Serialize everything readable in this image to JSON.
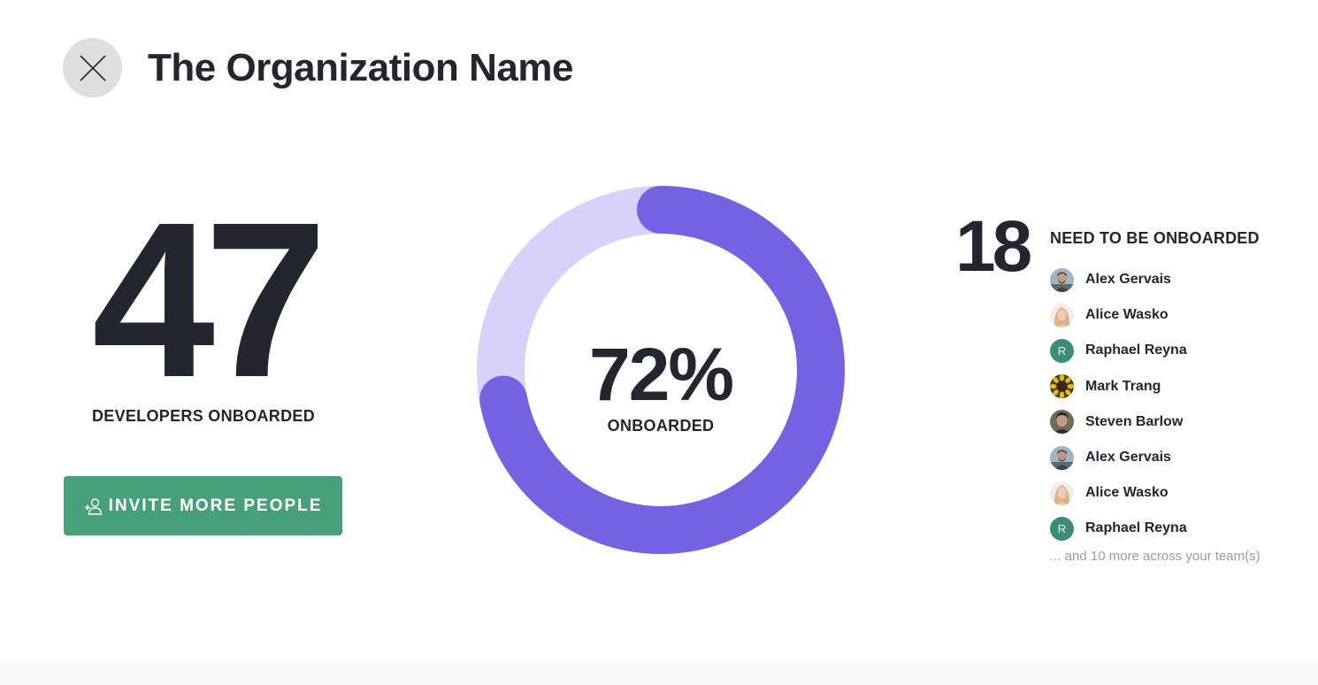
{
  "header": {
    "close_icon": "close-icon",
    "title": "The Organization Name"
  },
  "onboarded": {
    "count": "47",
    "label": "DEVELOPERS ONBOARDED",
    "invite_button": {
      "icon": "add-user-icon",
      "label": "INVITE MORE PEOPLE"
    }
  },
  "progress": {
    "percent_text": "72%",
    "percent_value": 0.72,
    "label": "ONBOARDED",
    "colors": {
      "filled": "#7462e2",
      "track": "#d8d2fa"
    }
  },
  "pending": {
    "count": "18",
    "heading": "NEED TO BE ONBOARDED",
    "people": [
      {
        "name": "Alex Gervais",
        "avatar": "photo-man-beard"
      },
      {
        "name": "Alice Wasko",
        "avatar": "photo-woman-blonde"
      },
      {
        "name": "Raphael Reyna",
        "avatar": "initial",
        "initial": "R"
      },
      {
        "name": "Mark Trang",
        "avatar": "photo-sunflower"
      },
      {
        "name": "Steven Barlow",
        "avatar": "photo-man-dark-hair"
      },
      {
        "name": "Alex Gervais",
        "avatar": "photo-man-beard"
      },
      {
        "name": "Alice Wasko",
        "avatar": "photo-woman-blonde"
      },
      {
        "name": "Raphael Reyna",
        "avatar": "initial",
        "initial": "R"
      }
    ],
    "more_note": "... and 10 more across your team(s)"
  },
  "colors": {
    "text": "#25252f",
    "button": "#48a07b",
    "close_bg": "#dedede",
    "avatar_initial_bg": "#3d8c78"
  }
}
